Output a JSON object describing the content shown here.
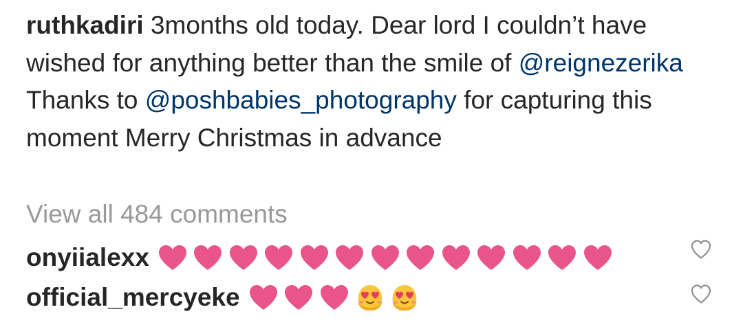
{
  "caption": {
    "username": "ruthkadiri",
    "segments": [
      {
        "text": " 3months old today. Dear lord I couldn’t have wished for anything better than the smile of ",
        "mention": false
      },
      {
        "text": "@reignezerika",
        "mention": true
      },
      {
        "text": "  Thanks to ",
        "mention": false
      },
      {
        "text": "@poshbabies_photography",
        "mention": true
      },
      {
        "text": " for capturing this moment  Merry Christmas in advance",
        "mention": false
      }
    ]
  },
  "view_all_comments": "View all 484 comments",
  "comments": [
    {
      "username": "onyiialexx",
      "emojis": [
        "heart",
        "heart",
        "heart",
        "heart",
        "heart",
        "heart",
        "heart",
        "heart",
        "heart",
        "heart",
        "heart",
        "heart",
        "heart"
      ]
    },
    {
      "username": "official_mercyeke",
      "emojis": [
        "heart",
        "heart",
        "heart",
        "smiling-face-with-heart-eyes",
        "smiling-face-with-heart-eyes"
      ]
    }
  ],
  "colors": {
    "text": "#262626",
    "mention": "#003569",
    "muted": "#999999",
    "heart_emoji": "#e9558a",
    "like_outline": "#8e8e8e"
  },
  "icons": {
    "heart_emoji": "heart-emoji",
    "face_emoji": "smiling-face-with-heart-eyes-emoji",
    "like": "heart-outline-icon"
  }
}
